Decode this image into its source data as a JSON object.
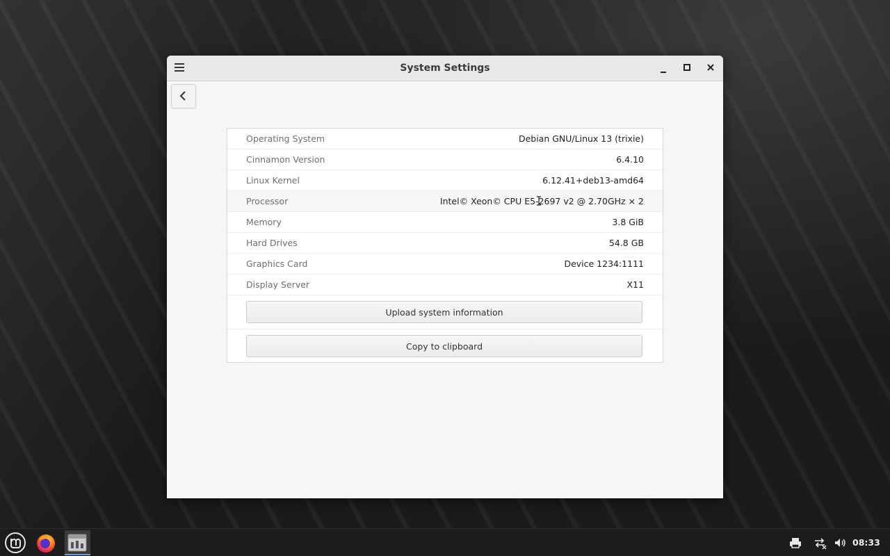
{
  "window": {
    "title": "System Settings"
  },
  "info_rows": [
    {
      "label": "Operating System",
      "value": "Debian GNU/Linux 13 (trixie)"
    },
    {
      "label": "Cinnamon Version",
      "value": "6.4.10"
    },
    {
      "label": "Linux Kernel",
      "value": "6.12.41+deb13-amd64"
    },
    {
      "label": "Processor",
      "value": "Intel© Xeon© CPU E5-2697 v2 @ 2.70GHz × 2"
    },
    {
      "label": "Memory",
      "value": "3.8 GiB"
    },
    {
      "label": "Hard Drives",
      "value": "54.8 GB"
    },
    {
      "label": "Graphics Card",
      "value": "Device 1234:1111"
    },
    {
      "label": "Display Server",
      "value": "X11"
    }
  ],
  "buttons": {
    "upload": "Upload system information",
    "copy": "Copy to clipboard"
  },
  "taskbar": {
    "clock": "08:33",
    "icons": [
      "mint-menu-icon",
      "firefox-icon",
      "system-settings-icon",
      "printer-icon",
      "network-icon",
      "volume-icon"
    ]
  },
  "colors": {
    "accent": "#6d9bd6",
    "window_bg": "#f6f6f6",
    "panel_bg": "#ffffff",
    "taskbar_bg": "#1c1c1c"
  }
}
